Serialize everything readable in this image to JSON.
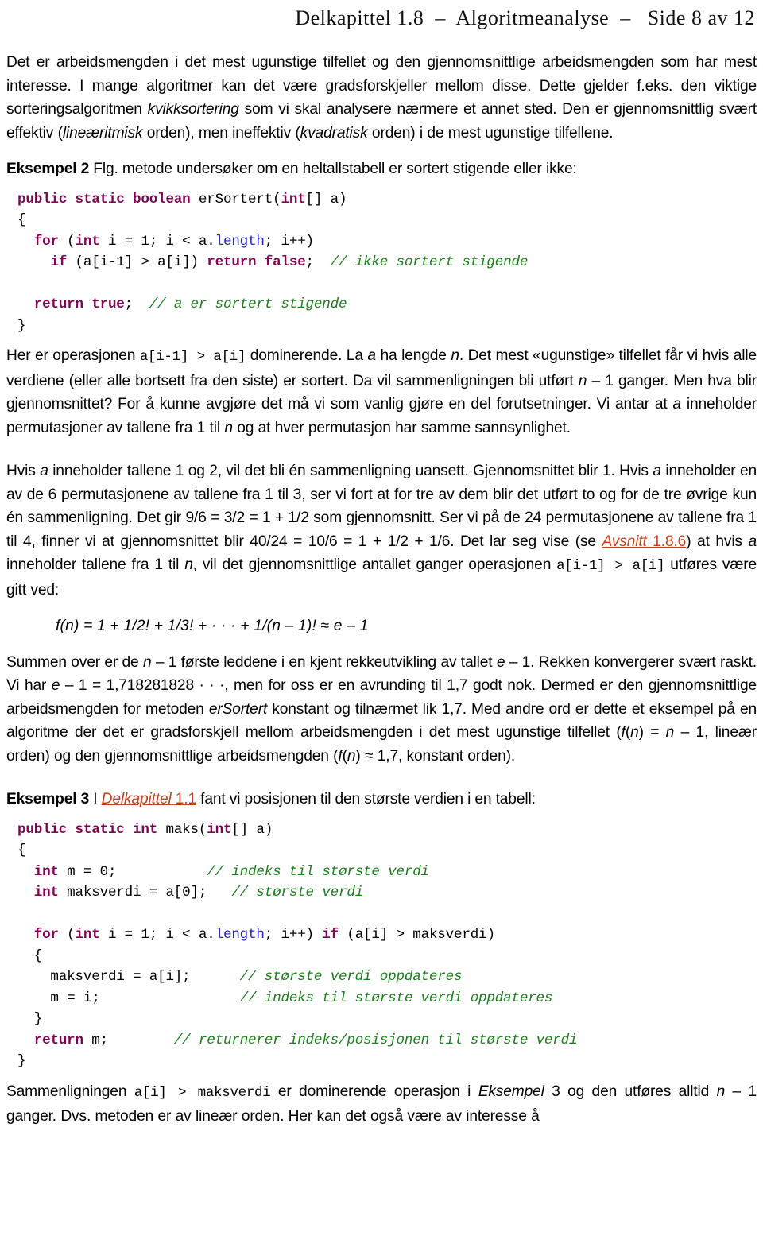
{
  "header": {
    "text": "Delkapittel 1.8  –  Algoritmeanalyse  –   Side 8 av 12"
  },
  "colors": {
    "keyword": "#7D0552",
    "comment": "#1E7B1E",
    "field": "#2222B0",
    "link": "#C0431F",
    "text": "#000000",
    "background": "#FFFFFF"
  },
  "paragraphs": {
    "p1": {
      "s1": "Det er arbeidsmengden i det mest ugunstige tilfellet og den gjennomsnittlige arbeidsmengden som har mest interesse. I mange algoritmer kan det være gradsforskjeller mellom disse. Dette gjelder f.eks. den viktige sorteringsalgoritmen ",
      "em1": "kvikksortering",
      "s2": " som vi skal analysere nærmere et annet sted. Den er gjennomsnittlig svært effektiv (",
      "em2": "lineæritmisk",
      "s3": " orden), men ineffektiv (",
      "em3": "kvadratisk",
      "s4": " orden) i de mest ugunstige tilfellene."
    },
    "p2": {
      "s1": "Her er operasjonen ",
      "code1": "a[i-1] > a[i]",
      "s2": " dominerende. La ",
      "em1": "a",
      "s3": " ha lengde ",
      "em2": "n",
      "s4": ". Det mest «ugunstige» tilfellet får vi hvis alle verdiene (eller alle bortsett fra den siste) er sortert. Da vil sammenligningen bli utført ",
      "em3": "n",
      "s5": " – 1 ganger. Men hva blir gjennomsnittet? For å kunne avgjøre det må vi som vanlig gjøre en del forutsetninger. Vi antar at ",
      "em4": "a",
      "s6": " inneholder permutasjoner av tallene fra 1 til ",
      "em5": "n",
      "s7": " og at hver permutasjon har samme sannsynlighet."
    },
    "p3": {
      "s1": "Hvis ",
      "em1": "a",
      "s2": " inneholder tallene 1 og 2, vil det bli én sammenligning uansett. Gjennomsnittet blir 1. Hvis ",
      "em2": "a",
      "s3": " inneholder en av de 6 permutasjonene av tallene fra 1 til 3, ser vi fort at for tre av dem blir det utført to og for de tre øvrige kun én sammenligning. Det gir 9/6 = 3/2 = 1 + 1/2 som gjennomsnitt. Ser vi på de 24 permutasjonene av tallene fra 1 til 4, finner vi at gjennomsnittet blir 40/24 = 10/6 = 1 + 1/2 + 1/6. Det lar seg vise (se ",
      "link1_em": "Avsnitt",
      "link1_rest": " 1.8.6",
      "s4": ") at hvis ",
      "em3": "a",
      "s5": " inneholder tallene fra 1 til ",
      "em4": "n",
      "s6": ", vil det gjennomsnittlige antallet ganger operasjonen ",
      "code1": "a[i-1] > a[i]",
      "s7": " utføres være gitt ved:"
    },
    "p4": {
      "s1": "Summen over er de ",
      "em1": "n",
      "s2": " – 1 første leddene i en kjent rekkeutvikling av tallet ",
      "em2": "e",
      "s3": " – 1. Rekken konvergerer svært raskt. Vi har ",
      "em3": "e",
      "s4": " – 1 = 1,718281828 · · ·, men for oss er en avrunding til 1,7 godt nok. Dermed er den gjennomsnittlige arbeidsmengden for metoden ",
      "em4": "erSortert",
      "s5": " konstant og tilnærmet lik 1,7. Med andre ord er dette et eksempel på en algoritme der det er gradsforskjell mellom arbeidsmengden i det mest ugunstige tilfellet (",
      "em5": "f",
      "s6": "(",
      "em6": "n",
      "s7": ") = ",
      "em7": "n",
      "s8": " – 1, lineær orden) og den gjennomsnittlige arbeidsmengden (",
      "em8": "f",
      "s9": "(",
      "em9": "n",
      "s10": ") ≈ 1,7, konstant orden)."
    },
    "p5": {
      "s1": "Sammenligningen ",
      "code1": "a[i] > maksverdi",
      "s2": " er dominerende operasjon i ",
      "em1": "Eksempel",
      "s3": " 3 og den utføres alltid ",
      "em2": "n",
      "s4": " – 1 ganger. Dvs. metoden er av lineær orden. Her kan det også være av interesse å"
    }
  },
  "examples": {
    "ex2": {
      "label": "Eksempel 2",
      "text": "  Flg. metode undersøker om en heltallstabell er sortert stigende eller ikke:"
    },
    "ex3": {
      "label": "Eksempel 3",
      "pre": "  I ",
      "link_em": "Delkapittel",
      "link_rest": " 1.1",
      "post": " fant vi posisjonen til den største verdien i en tabell:"
    }
  },
  "formula": {
    "text": "f(n) = 1 + 1/2! + 1/3! + ·  ·  ·  +  1/(n – 1)!  ≈  e – 1"
  },
  "code_blocks": {
    "block1": {
      "name": "erSortert",
      "lines": [
        [
          {
            "t": "public static boolean ",
            "c": "kw"
          },
          {
            "t": "erSortert(",
            "c": ""
          },
          {
            "t": "int",
            "c": "kw"
          },
          {
            "t": "[] a)",
            "c": ""
          }
        ],
        [
          {
            "t": "{",
            "c": ""
          }
        ],
        [
          {
            "t": "  ",
            "c": ""
          },
          {
            "t": "for",
            "c": "kw"
          },
          {
            "t": " (",
            "c": ""
          },
          {
            "t": "int",
            "c": "kw"
          },
          {
            "t": " i = 1; i < a.",
            "c": ""
          },
          {
            "t": "length",
            "c": "fld"
          },
          {
            "t": "; i++)",
            "c": ""
          }
        ],
        [
          {
            "t": "    ",
            "c": ""
          },
          {
            "t": "if",
            "c": "kw"
          },
          {
            "t": " (a[i-1] > a[i]) ",
            "c": ""
          },
          {
            "t": "return false",
            "c": "kw"
          },
          {
            "t": ";  ",
            "c": ""
          },
          {
            "t": "// ikke sortert stigende",
            "c": "cm"
          }
        ],
        [
          {
            "t": "",
            "c": ""
          }
        ],
        [
          {
            "t": "  ",
            "c": ""
          },
          {
            "t": "return true",
            "c": "kw"
          },
          {
            "t": ";  ",
            "c": ""
          },
          {
            "t": "// a er sortert stigende",
            "c": "cm"
          }
        ],
        [
          {
            "t": "}",
            "c": ""
          }
        ]
      ]
    },
    "block2": {
      "name": "maks",
      "lines": [
        [
          {
            "t": "public static int ",
            "c": "kw"
          },
          {
            "t": "maks(",
            "c": ""
          },
          {
            "t": "int",
            "c": "kw"
          },
          {
            "t": "[] a)",
            "c": ""
          }
        ],
        [
          {
            "t": "{",
            "c": ""
          }
        ],
        [
          {
            "t": "  ",
            "c": ""
          },
          {
            "t": "int",
            "c": "kw"
          },
          {
            "t": " m = 0;           ",
            "c": ""
          },
          {
            "t": "// indeks til største verdi",
            "c": "cm"
          }
        ],
        [
          {
            "t": "  ",
            "c": ""
          },
          {
            "t": "int",
            "c": "kw"
          },
          {
            "t": " maksverdi = a[0];   ",
            "c": ""
          },
          {
            "t": "// største verdi",
            "c": "cm"
          }
        ],
        [
          {
            "t": "",
            "c": ""
          }
        ],
        [
          {
            "t": "  ",
            "c": ""
          },
          {
            "t": "for",
            "c": "kw"
          },
          {
            "t": " (",
            "c": ""
          },
          {
            "t": "int",
            "c": "kw"
          },
          {
            "t": " i = 1; i < a.",
            "c": ""
          },
          {
            "t": "length",
            "c": "fld"
          },
          {
            "t": "; i++) ",
            "c": ""
          },
          {
            "t": "if",
            "c": "kw"
          },
          {
            "t": " (a[i] > maksverdi)",
            "c": ""
          }
        ],
        [
          {
            "t": "  {",
            "c": ""
          }
        ],
        [
          {
            "t": "    maksverdi = a[i];      ",
            "c": ""
          },
          {
            "t": "// største verdi oppdateres",
            "c": "cm"
          }
        ],
        [
          {
            "t": "    m = i;                 ",
            "c": ""
          },
          {
            "t": "// indeks til største verdi oppdateres",
            "c": "cm"
          }
        ],
        [
          {
            "t": "  }",
            "c": ""
          }
        ],
        [
          {
            "t": "  ",
            "c": ""
          },
          {
            "t": "return",
            "c": "kw"
          },
          {
            "t": " m;        ",
            "c": ""
          },
          {
            "t": "// returnerer indeks/posisjonen til største verdi",
            "c": "cm"
          }
        ],
        [
          {
            "t": "}",
            "c": ""
          }
        ]
      ]
    }
  }
}
